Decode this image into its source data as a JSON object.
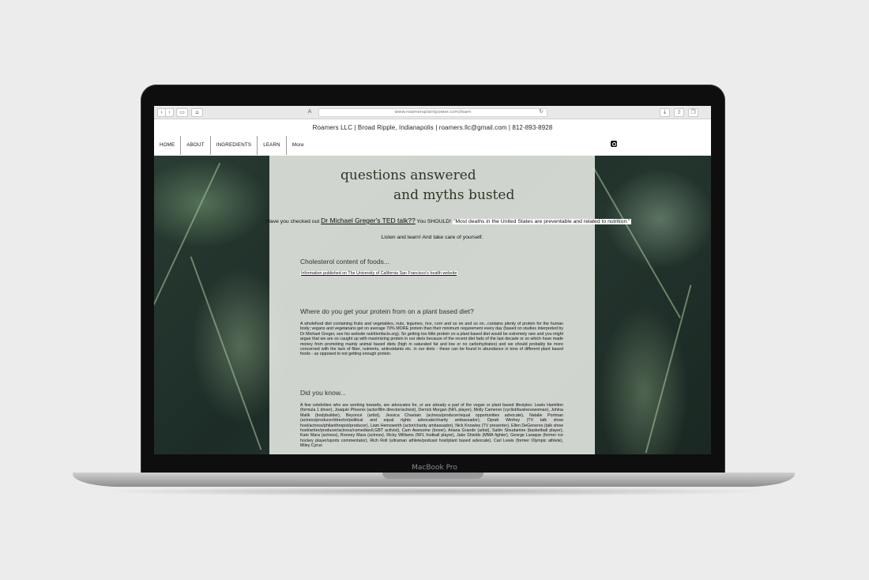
{
  "device": {
    "label": "MacBook Pro"
  },
  "browser": {
    "url": "www.roamersplantpower.com/learn",
    "back_icon": "chevron-left-icon",
    "forward_icon": "chevron-right-icon",
    "back_glyph": "‹",
    "forward_glyph": "›",
    "sidebar_glyph": "▭",
    "home_glyph": "⌂",
    "reader_glyph": "A",
    "reload_glyph": "↻",
    "download_glyph": "↓",
    "share_glyph": "⇧",
    "tabs_glyph": "❐"
  },
  "header": {
    "contact": "Roamers LLC | Broad Ripple, Indianapolis | roamers.llc@gmail.com | 812-893-8928",
    "nav": [
      "HOME",
      "ABOUT",
      "INGREDIENTS",
      "LEARN",
      "More"
    ],
    "social_icon": "instagram-icon"
  },
  "page": {
    "heading_line1": "questions answered",
    "heading_line2": "and myths busted",
    "ted_prefix": "Have you checked out",
    "ted_link": "Dr Michael Greger's TED talk??",
    "ted_suffix": "You SHOULD!",
    "ted_quote": "\"Most deaths in the United States are preventable and related to nutrition.\"",
    "listen": "Listen and learn! And take care of yourself.",
    "cholesterol_title": "Cholesterol content of foods...",
    "cholesterol_link": "Information published on The University of California San Francisco's health website",
    "protein_title": "Where do you get your protein from on a plant based diet?",
    "protein_body": "A wholefood diet containing fruits and vegetables, nuts, legumes, rice, corn and so on and so on...contains plenty of protein for the human body; vegans and vegetarians get on average 70% MORE protein than their minimum requirement every day (based on studies interpreted by Dr Michael Greger, see his website nutritionfacts.org). So getting too little protein on a plant based diet would be extremely rare and you might argue that we are so caught up with maximizing protein in our diets because of the recent diet fads of the last decade or so which have made money from promoting mainly animal based diets (high in saturated fat and low or no carbohydrates) and we should probably be more concerned with the lack of fiber, nutrients, antioxidants  etc. in our diets - these can be found in abundance in tons of different plant based foods - as opposed to not getting enough protein.",
    "didyouknow_title": "Did you know...",
    "didyouknow_body": "A few celebrities who are working towards, are advocates for, or are already a part of the vegan or plant based lifestyles: Lewis Hamilton (formula 1 driver), Joaquin Phoenix (actor/film director/activist), Derrick Morgan (NFL player), Molly Cameron (cyclist/businesswoman), Johina Malik (bodybuilder), Beyoncé (artist), Jessica Chastain (actress/producer/equal opportunities advocate), Natalie Portman (actress/producer/director/political and equal rights advocate/charity ambassador), Oprah Winfrey (TV talk show host/actress/philanthropist/producer), Liam Hemsworth (actor/charity ambassador), Nick Knowles (TV presenter), Ellen DeGeneres (talk show host/writer/producer/actress/comedian/LGBT activist), Cam Awesome (boxer), Ariana Grande (artist), Salim Stoudamire (basketball player), Kate Mara (actress), Rooney Mara (actress), Ricky Williams (NFL football player), Jake Shields (MMA fighter), George Laraque (former ice hockey player/sports commentator), Rich Roll (ultraman athlete/podcast host/plant based advocate), Carl Lewis (former Olympic athlete), Miley Cyrus"
  }
}
